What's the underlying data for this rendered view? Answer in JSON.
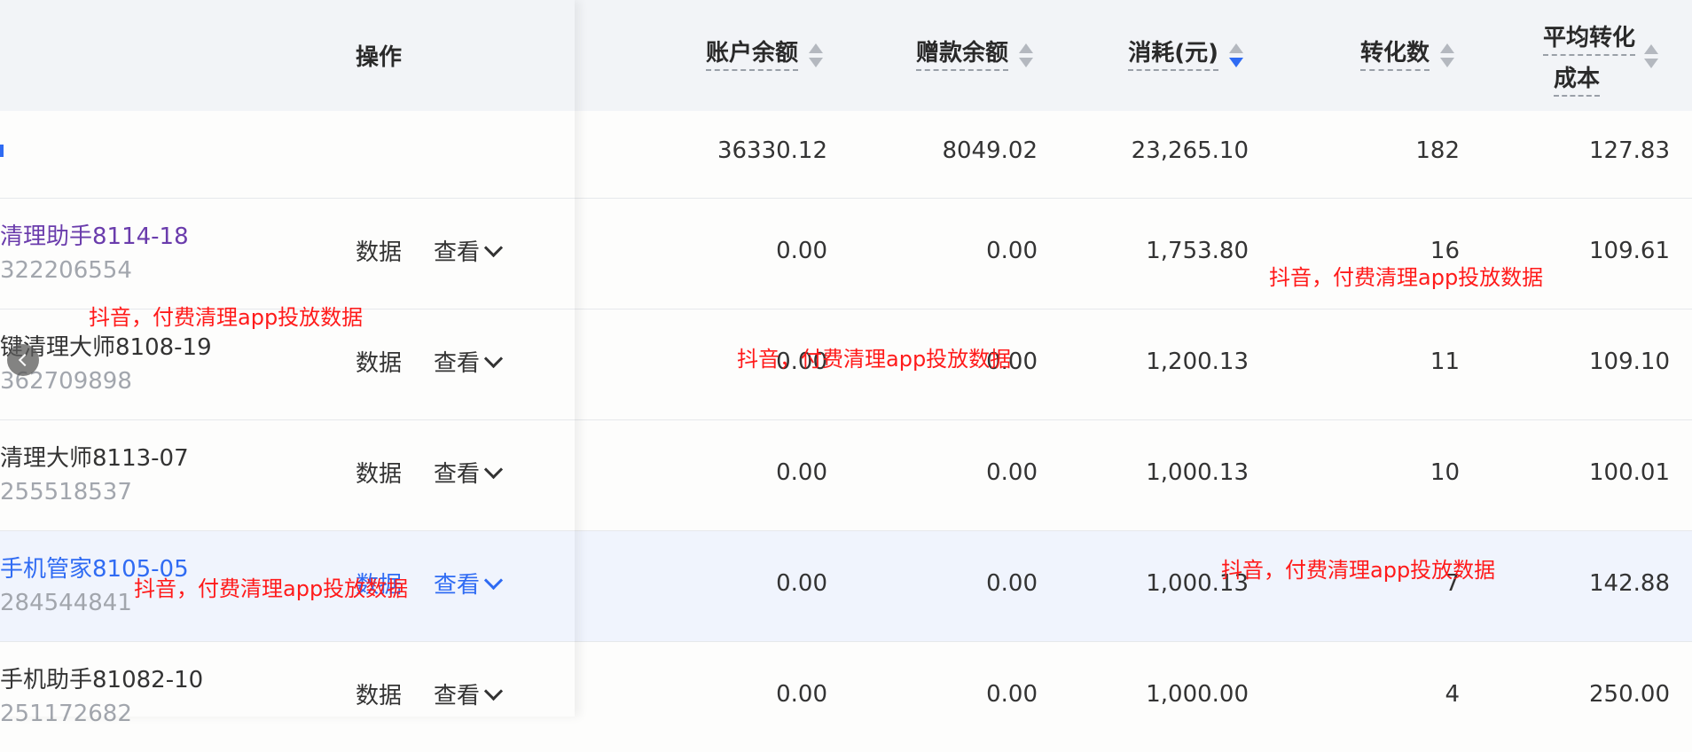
{
  "header": {
    "operation": "操作",
    "balance": "账户余额",
    "bonus_balance": "赠款余额",
    "spend": "消耗(元)",
    "conversions": "转化数",
    "avg_cost_line1": "平均转化",
    "avg_cost_line2": "成本"
  },
  "summary": {
    "balance": "36330.12",
    "bonus_balance": "8049.02",
    "spend": "23,265.10",
    "conversions": "182",
    "avg_cost": "127.83"
  },
  "rows": [
    {
      "name": "清理助手8114-18",
      "account": "322206554",
      "action_data": "数据",
      "action_view": "查看",
      "balance": "0.00",
      "bonus_balance": "0.00",
      "spend": "1,753.80",
      "conversions": "16",
      "avg_cost": "109.61"
    },
    {
      "name": "键清理大师8108-19",
      "account": "362709898",
      "action_data": "数据",
      "action_view": "查看",
      "balance": "0.00",
      "bonus_balance": "0.00",
      "spend": "1,200.13",
      "conversions": "11",
      "avg_cost": "109.10"
    },
    {
      "name": "清理大师8113-07",
      "account": "255518537",
      "action_data": "数据",
      "action_view": "查看",
      "balance": "0.00",
      "bonus_balance": "0.00",
      "spend": "1,000.13",
      "conversions": "10",
      "avg_cost": "100.01"
    },
    {
      "name": "手机管家8105-05",
      "account": "284544841",
      "action_data": "数据",
      "action_view": "查看",
      "balance": "0.00",
      "bonus_balance": "0.00",
      "spend": "1,000.13",
      "conversions": "7",
      "avg_cost": "142.88"
    },
    {
      "name": "手机助手81082-10",
      "account": "251172682",
      "action_data": "数据",
      "action_view": "查看",
      "balance": "0.00",
      "bonus_balance": "0.00",
      "spend": "1,000.00",
      "conversions": "4",
      "avg_cost": "250.00"
    }
  ],
  "watermark": "抖音，付费清理app投放数据",
  "colors": {
    "accent": "#2f6bf3",
    "visited_link": "#6a3cac",
    "watermark": "#ff1a1a",
    "header_bg": "#f2f4f7",
    "highlight_row": "#f0f4fd"
  },
  "icons": {
    "sort": "sort-caret-icon",
    "chevron": "chevron-down-icon",
    "prev": "chevron-left-icon"
  }
}
